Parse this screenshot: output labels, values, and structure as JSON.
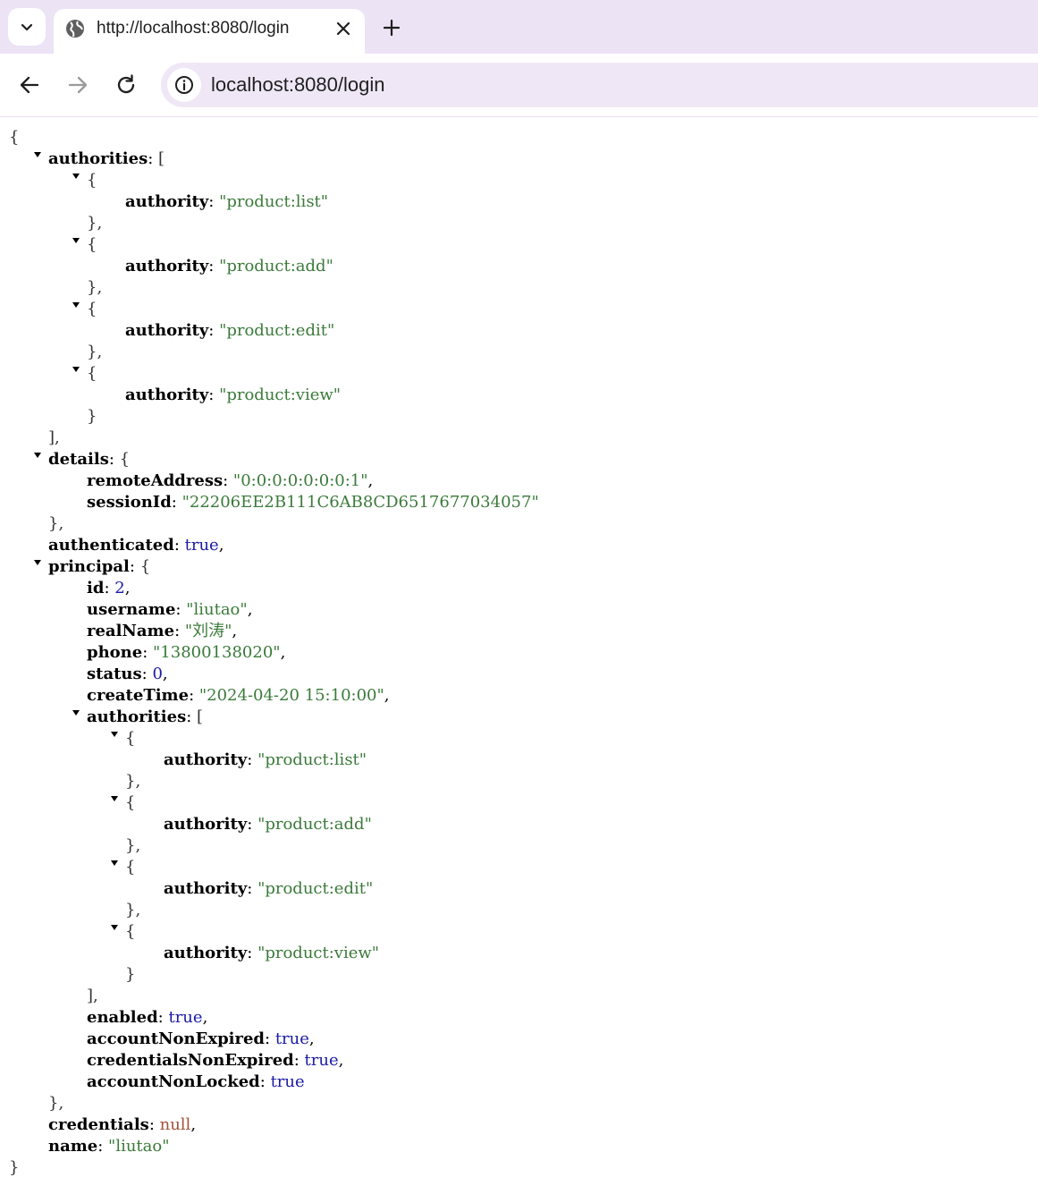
{
  "browser": {
    "tab_title": "http://localhost:8080/login",
    "url": "localhost:8080/login",
    "icons": {
      "tab_list": "chevron-down-icon",
      "favicon": "globe-icon",
      "close": "close-icon",
      "new_tab": "plus-icon",
      "back": "arrow-left-icon",
      "forward": "arrow-right-icon",
      "reload": "reload-icon",
      "site_info": "info-icon"
    }
  },
  "json": {
    "authorities": [
      "product:list",
      "product:add",
      "product:edit",
      "product:view"
    ],
    "details": {
      "remoteAddress": "0:0:0:0:0:0:0:1",
      "sessionId": "22206EE2B111C6AB8CD6517677034057"
    },
    "authenticated": "true",
    "principal": {
      "id": "2",
      "username": "liutao",
      "realName": "刘涛",
      "phone": "13800138020",
      "status": "0",
      "createTime": "2024-04-20 15:10:00",
      "authorities": [
        "product:list",
        "product:add",
        "product:edit",
        "product:view"
      ],
      "enabled": "true",
      "accountNonExpired": "true",
      "credentialsNonExpired": "true",
      "accountNonLocked": "true"
    },
    "credentials": "null",
    "name": "liutao"
  },
  "colors": {
    "string": "#3a7a3a",
    "number": "#1a1aa6",
    "boolean": "#1a1aa6",
    "null": "#a0523a",
    "tabstrip": "#ece3f5",
    "omnibox": "#efe7f6"
  }
}
